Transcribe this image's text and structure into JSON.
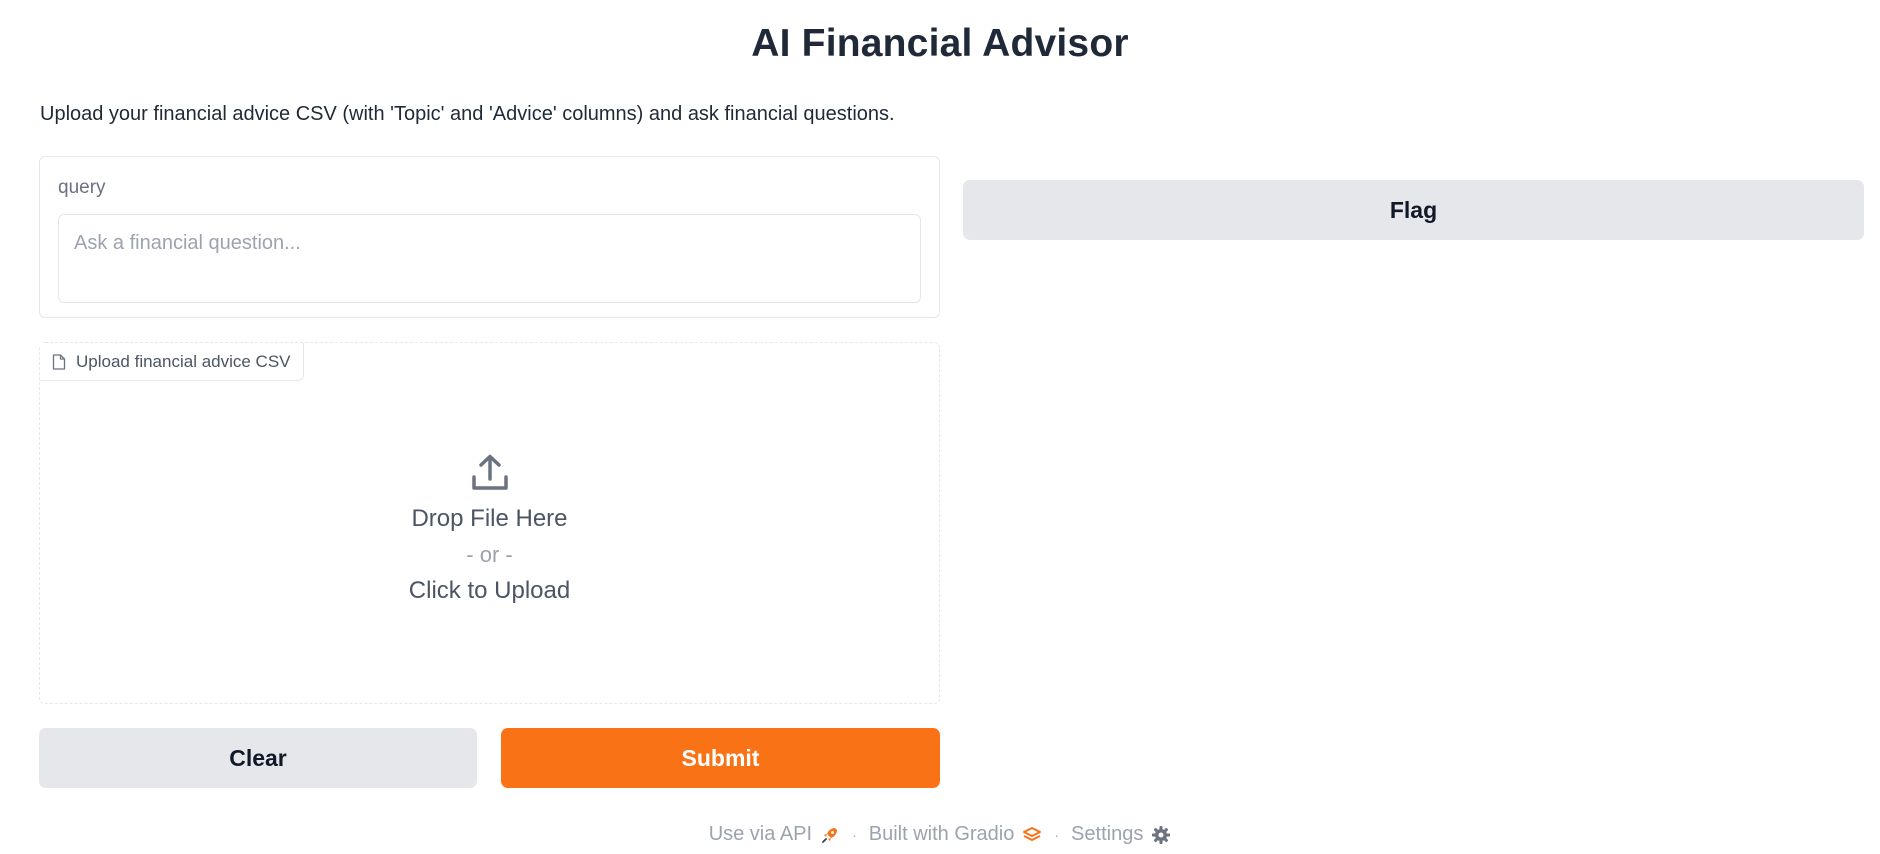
{
  "app": {
    "title": "AI Financial Advisor",
    "description": "Upload your financial advice CSV (with 'Topic' and 'Advice' columns) and ask financial questions."
  },
  "query": {
    "label": "query",
    "placeholder": "Ask a financial question...",
    "value": ""
  },
  "upload": {
    "label": "Upload financial advice CSV",
    "drop_text": "Drop File Here",
    "or_text": "- or -",
    "click_text": "Click to Upload"
  },
  "buttons": {
    "clear": "Clear",
    "submit": "Submit",
    "flag": "Flag"
  },
  "footer": {
    "api": "Use via API",
    "built_with": "Built with Gradio",
    "settings": "Settings",
    "separator": "·"
  },
  "colors": {
    "accent": "#f97316",
    "secondary_button": "#e5e7eb"
  },
  "icons": {
    "file": "file-icon",
    "upload": "upload-icon",
    "api": "rocket-icon",
    "gradio": "gradio-logo-icon",
    "settings": "gear-icon"
  }
}
